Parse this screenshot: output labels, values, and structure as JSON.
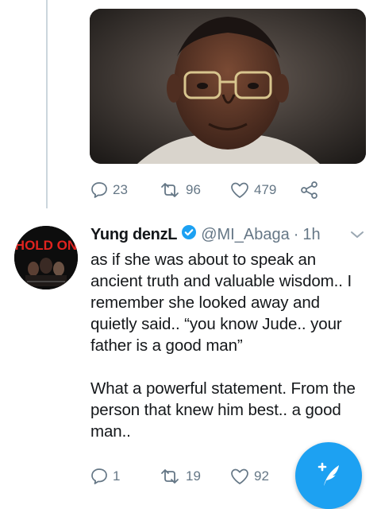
{
  "tweet_prev": {
    "actions": {
      "replies": "23",
      "retweets": "96",
      "likes": "479"
    }
  },
  "tweet": {
    "display_name": "Yung denzL",
    "handle": "@MI_Abaga",
    "separator": "·",
    "time": "1h",
    "text": "as if she was about to speak an ancient truth and valuable wisdom.. I remember she looked away and quietly said.. “you know Jude.. your father is a good man”\n\nWhat a powerful statement. From the person that knew him best.. a good man..",
    "avatar_text": "HOLD ON",
    "actions": {
      "replies": "1",
      "retweets": "19",
      "likes": "92"
    }
  },
  "colors": {
    "accent": "#1da1f2",
    "muted": "#657786",
    "text": "#14171a"
  }
}
